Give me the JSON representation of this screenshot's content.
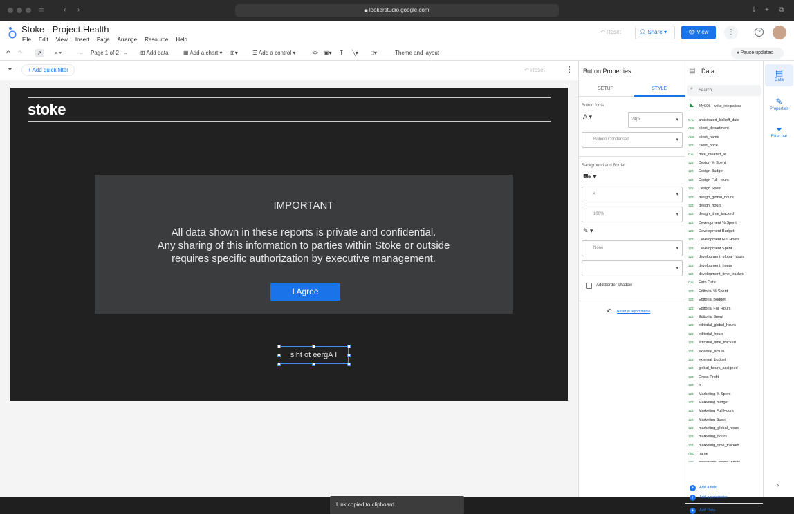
{
  "browser": {
    "url": "lookerstudio.google.com"
  },
  "app": {
    "title": "Stoke - Project Health",
    "menu": [
      "File",
      "Edit",
      "View",
      "Insert",
      "Page",
      "Arrange",
      "Resource",
      "Help"
    ],
    "reset_label": "Reset",
    "share_label": "Share",
    "view_label": "View"
  },
  "toolbar": {
    "page_indicator": "Page 1 of 2",
    "add_data": "Add data",
    "add_chart": "Add a chart",
    "add_control": "Add a control",
    "theme_layout": "Theme and layout",
    "pause_updates": "Pause updates"
  },
  "filterbar": {
    "quick_filter": "+ Add quick filter",
    "reset": "Reset"
  },
  "canvas": {
    "brand": "stoke",
    "notice_title": "IMPORTANT",
    "notice_lines": [
      "All data shown in these reports is private and confidential.",
      "Any sharing of this information to parties within Stoke or outside",
      "requires specific authorization by executive management."
    ],
    "agree_button": "I Agree",
    "selected_button": "siht ot eergA I"
  },
  "toast": "Link copied to clipboard.",
  "properties": {
    "title": "Button Properties",
    "tab_setup": "SETUP",
    "tab_style": "STYLE",
    "button_fonts": "Button fonts",
    "font_size": "24px",
    "font_family": "Roboto Condensed",
    "background_border": "Background and Border",
    "radius": "4",
    "opacity": "100%",
    "border_style": "None",
    "add_border_shadow": "Add border shadow",
    "reset_theme": "Reset to report theme"
  },
  "data": {
    "title": "Data",
    "search_placeholder": "Search",
    "source": "MySQL - wrike_integrations",
    "fields": [
      {
        "t": "CAL",
        "name": "anticipated_kickoff_date"
      },
      {
        "t": "ABC",
        "name": "client_department"
      },
      {
        "t": "ABC",
        "name": "client_name"
      },
      {
        "t": "123",
        "name": "client_price"
      },
      {
        "t": "CAL",
        "name": "date_created_at"
      },
      {
        "t": "123",
        "name": "Design % Spent"
      },
      {
        "t": "123",
        "name": "Design Budget"
      },
      {
        "t": "123",
        "name": "Design Full Hours"
      },
      {
        "t": "123",
        "name": "Design Spent"
      },
      {
        "t": "123",
        "name": "design_global_hours"
      },
      {
        "t": "123",
        "name": "design_hours"
      },
      {
        "t": "123",
        "name": "design_time_tracked"
      },
      {
        "t": "123",
        "name": "Development % Spent"
      },
      {
        "t": "123",
        "name": "Development Budget"
      },
      {
        "t": "123",
        "name": "Development Full Hours"
      },
      {
        "t": "123",
        "name": "Development Spent"
      },
      {
        "t": "123",
        "name": "development_global_hours"
      },
      {
        "t": "123",
        "name": "development_hours"
      },
      {
        "t": "123",
        "name": "development_time_tracked"
      },
      {
        "t": "CAL",
        "name": "Earn Date"
      },
      {
        "t": "123",
        "name": "Editorial % Spent"
      },
      {
        "t": "123",
        "name": "Editorial Budget"
      },
      {
        "t": "123",
        "name": "Editorial Full Hours"
      },
      {
        "t": "123",
        "name": "Editorial Spent"
      },
      {
        "t": "123",
        "name": "editorial_global_hours"
      },
      {
        "t": "123",
        "name": "editorial_hours"
      },
      {
        "t": "123",
        "name": "editorial_time_tracked"
      },
      {
        "t": "123",
        "name": "external_actual"
      },
      {
        "t": "123",
        "name": "external_budget"
      },
      {
        "t": "123",
        "name": "global_hours_assigned"
      },
      {
        "t": "123",
        "name": "Gross Profit"
      },
      {
        "t": "123",
        "name": "id"
      },
      {
        "t": "123",
        "name": "Marketing % Spent"
      },
      {
        "t": "123",
        "name": "Marketing Budget"
      },
      {
        "t": "123",
        "name": "Marketing Full Hours"
      },
      {
        "t": "123",
        "name": "Marketing Spent"
      },
      {
        "t": "123",
        "name": "marketing_global_hours"
      },
      {
        "t": "123",
        "name": "marketing_hours"
      },
      {
        "t": "123",
        "name": "marketing_time_tracked"
      },
      {
        "t": "ABC",
        "name": "name"
      },
      {
        "t": "123",
        "name": "operations_global_hours"
      }
    ],
    "add_field": "Add a field",
    "add_parameter": "Add a parameter",
    "add_data": "Add Data"
  },
  "rail": {
    "data": "Data",
    "properties": "Properties",
    "filter_bar": "Filter bar"
  },
  "colors": {
    "accent": "#1a73e8",
    "canvas_bg": "#212121",
    "notice_bg": "#3a3c3e"
  }
}
